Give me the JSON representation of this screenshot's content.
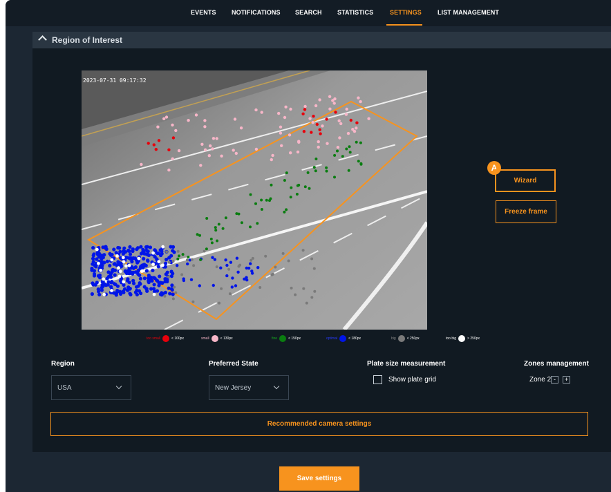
{
  "nav": {
    "items": [
      "EVENTS",
      "NOTIFICATIONS",
      "SEARCH",
      "STATISTICS",
      "SETTINGS",
      "LIST MANAGEMENT"
    ],
    "active": "SETTINGS"
  },
  "section": {
    "title": "Region of Interest",
    "icon": "chevron-up-icon"
  },
  "camera": {
    "timestamp": "2023-07-31 09:17:32"
  },
  "buttons": {
    "wizard": "Wizard",
    "wizard_badge": "A",
    "freeze": "Freeze frame",
    "recommended": "Recommended camera settings",
    "save": "Save settings"
  },
  "legend": [
    {
      "label": "too small",
      "size": "< 100px",
      "color": "#e8000b"
    },
    {
      "label": "small",
      "size": "< 130px",
      "color": "#f7b6c8"
    },
    {
      "label": "fine",
      "size": "< 150px",
      "color": "#0a7d10"
    },
    {
      "label": "optimal",
      "size": "< 180px",
      "color": "#0015e8"
    },
    {
      "label": "big",
      "size": "< 250px",
      "color": "#7a7a7a"
    },
    {
      "label": "too big",
      "size": "> 250px",
      "color": "#ffffff"
    }
  ],
  "fields": {
    "region_label": "Region",
    "region_value": "USA",
    "state_label": "Preferred State",
    "state_value": "New Jersey",
    "plate_label": "Plate size measurement",
    "plate_grid_label": "Show plate grid",
    "plate_grid_checked": false,
    "zones_label": "Zones management",
    "zone_value": "Zone 2",
    "zone_minus": "-",
    "zone_plus": "+"
  },
  "colors": {
    "accent": "#f7931e",
    "background": "#1c2733",
    "panel": "#111a22"
  }
}
